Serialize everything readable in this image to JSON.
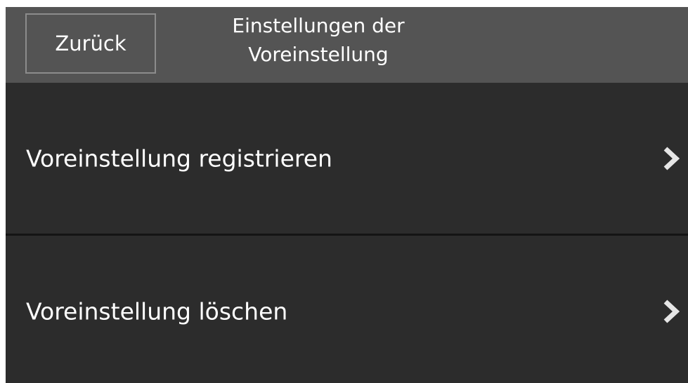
{
  "header": {
    "back_label": "Zurück",
    "title": "Einstellungen der\nVoreinstellung"
  },
  "menu": {
    "items": [
      {
        "label": "Voreinstellung registrieren",
        "icon": "chevron-right-icon"
      },
      {
        "label": "Voreinstellung löschen",
        "icon": "chevron-right-icon"
      }
    ]
  },
  "colors": {
    "header_bg": "#545454",
    "body_bg": "#2c2c2c",
    "text": "#ffffff",
    "chevron": "#e6e6e6"
  }
}
